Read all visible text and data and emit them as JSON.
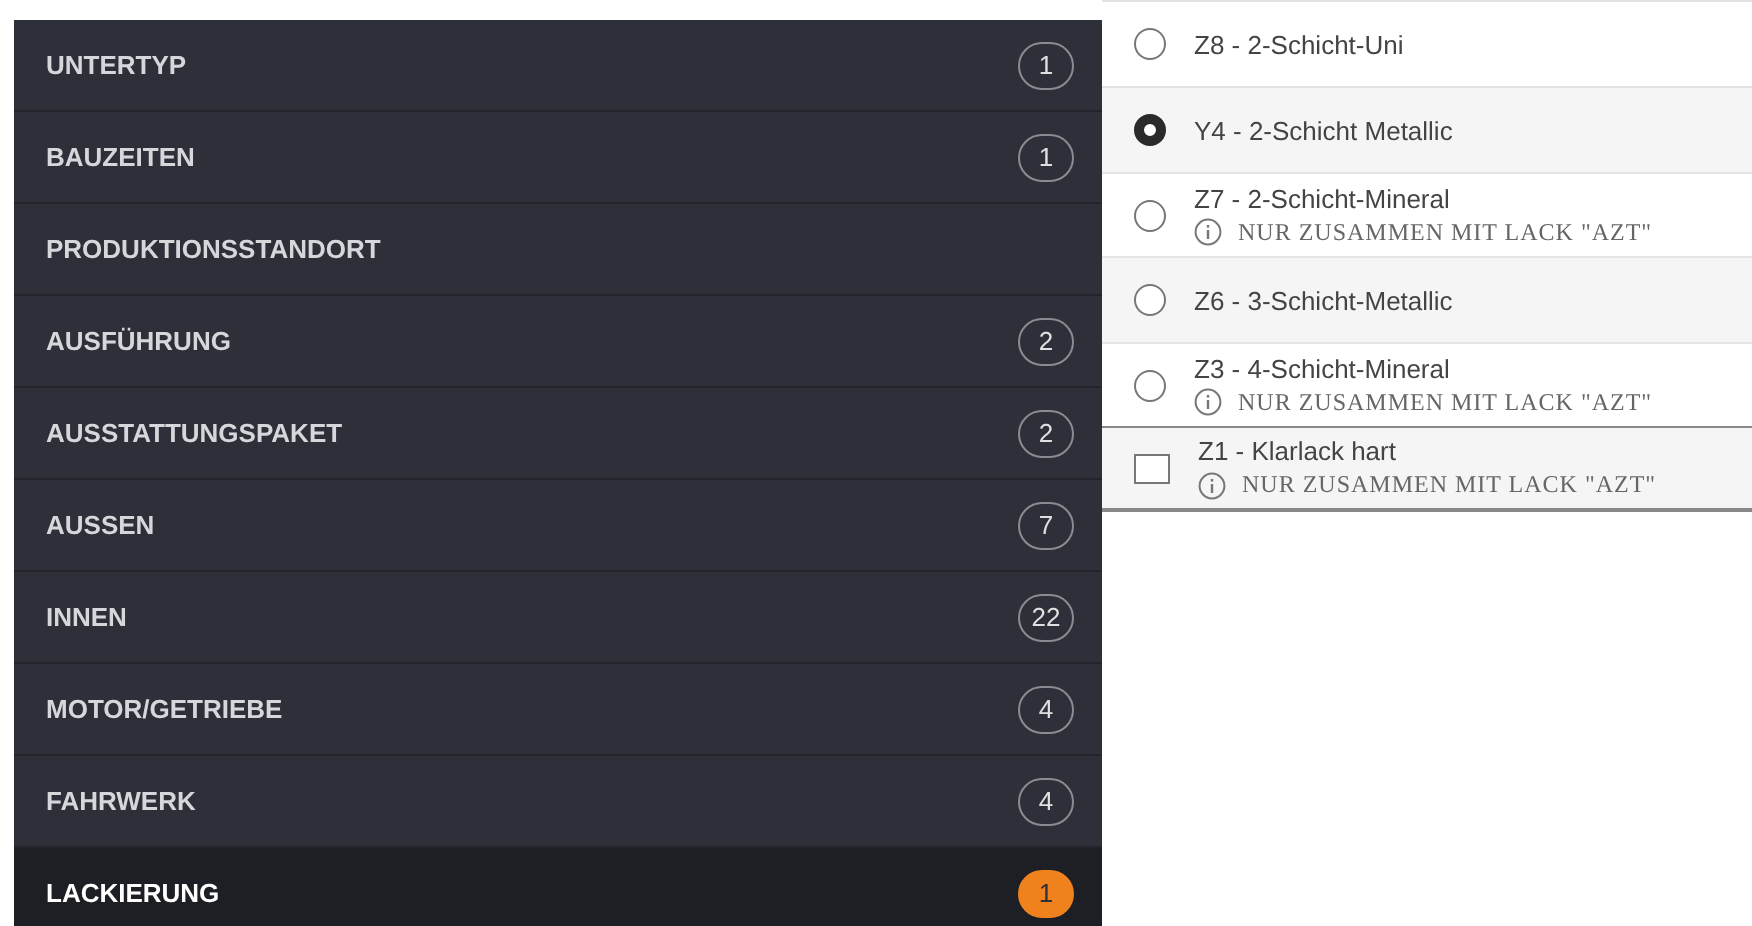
{
  "sidebar": {
    "items": [
      {
        "label": "UNTERTYP",
        "count": "1",
        "selected": false
      },
      {
        "label": "BAUZEITEN",
        "count": "1",
        "selected": false
      },
      {
        "label": "PRODUKTIONSSTANDORT",
        "selected": false
      },
      {
        "label": "AUSFÜHRUNG",
        "count": "2",
        "selected": false
      },
      {
        "label": "AUSSTATTUNGSPAKET",
        "count": "2",
        "selected": false
      },
      {
        "label": "AUSSEN",
        "count": "7",
        "selected": false
      },
      {
        "label": "INNEN",
        "count": "22",
        "selected": false
      },
      {
        "label": "MOTOR/GETRIEBE",
        "count": "4",
        "selected": false
      },
      {
        "label": "FAHRWERK",
        "count": "4",
        "selected": false
      },
      {
        "label": "LACKIERUNG",
        "count": "1",
        "selected": true
      }
    ]
  },
  "options": [
    {
      "kind": "radio",
      "label": "Z8 - 2-Schicht-Uni",
      "selected": false
    },
    {
      "kind": "radio",
      "label": "Y4 - 2-Schicht Metallic",
      "selected": true
    },
    {
      "kind": "radio",
      "label": "Z7 - 2-Schicht-Mineral",
      "note": "NUR ZUSAMMEN MIT LACK \"AZT\"",
      "selected": false
    },
    {
      "kind": "radio",
      "label": "Z6 - 3-Schicht-Metallic",
      "selected": false
    },
    {
      "kind": "radio",
      "label": "Z3 - 4-Schicht-Mineral",
      "note": "NUR ZUSAMMEN MIT LACK \"AZT\"",
      "selected": false
    },
    {
      "kind": "checkbox",
      "label": "Z1 - Klarlack hart",
      "note": "NUR ZUSAMMEN MIT LACK \"AZT\"",
      "checked": false
    }
  ]
}
